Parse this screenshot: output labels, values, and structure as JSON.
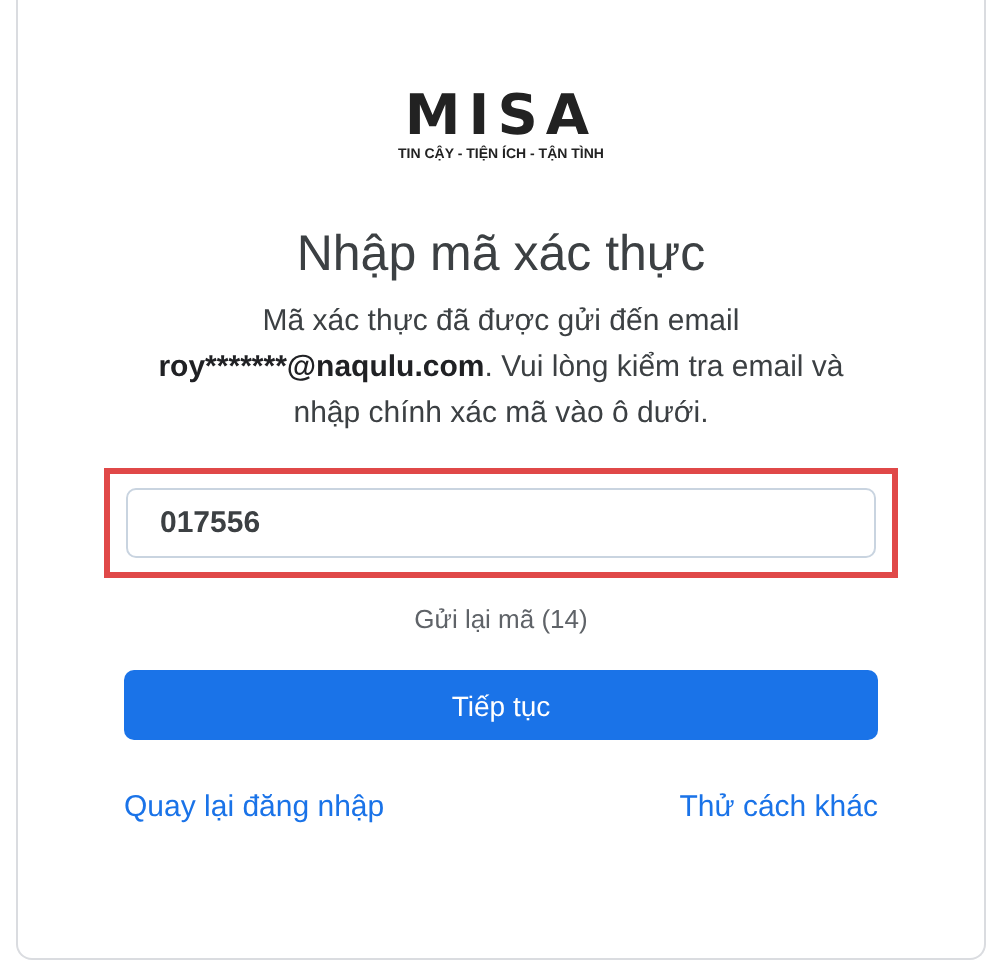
{
  "logo": {
    "brand": "MISA",
    "tagline": "TIN CẬY - TIỆN ÍCH - TẬN TÌNH"
  },
  "title": "Nhập mã xác thực",
  "description": {
    "before": "Mã xác thực đã được gửi đến email ",
    "email": "roy*******@naqulu.com",
    "after": ". Vui lòng kiểm tra email và nhập chính xác mã vào ô dưới."
  },
  "code_field": {
    "value": "017556",
    "highlighted": true
  },
  "resend": "Gửi lại mã (14)",
  "primary_button": "Tiếp tục",
  "links": [
    {
      "label": "Quay lại đăng nhập"
    },
    {
      "label": "Thử cách khác"
    }
  ]
}
